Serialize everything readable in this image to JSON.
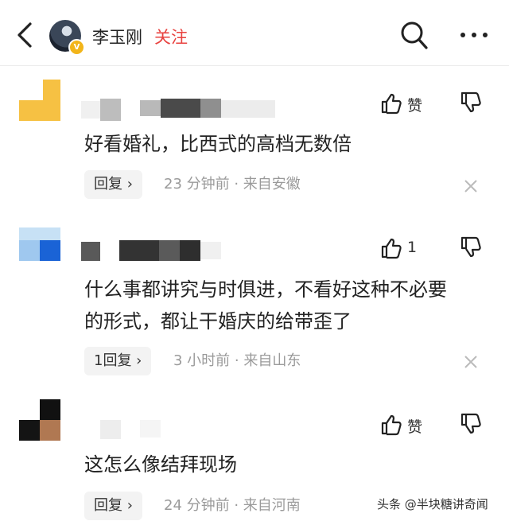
{
  "header": {
    "author_name": "李玉刚",
    "follow_label": "关注",
    "verified_badge": "V"
  },
  "comments": [
    {
      "text": "好看婚礼，比西式的高档无数倍",
      "like_label": "赞",
      "reply_label": "回复 ›",
      "meta": "23 分钟前 · 来自安徽"
    },
    {
      "text_line1": "什么事都讲究与时俱进，不看好这种不必要",
      "text_line2": "的形式，都让干婚庆的给带歪了",
      "like_label": "1",
      "reply_label": "1回复 ›",
      "meta": "3 小时前 · 来自山东"
    },
    {
      "text": "这怎么像结拜现场",
      "like_label": "赞",
      "reply_label": "回复 ›",
      "meta": "24 分钟前 · 来自河南"
    }
  ],
  "watermark": "头条 @半块糖讲奇闻",
  "colors": {
    "accent": "#e8423f",
    "badge": "#f2b51a",
    "meta": "#9a9a9a"
  }
}
